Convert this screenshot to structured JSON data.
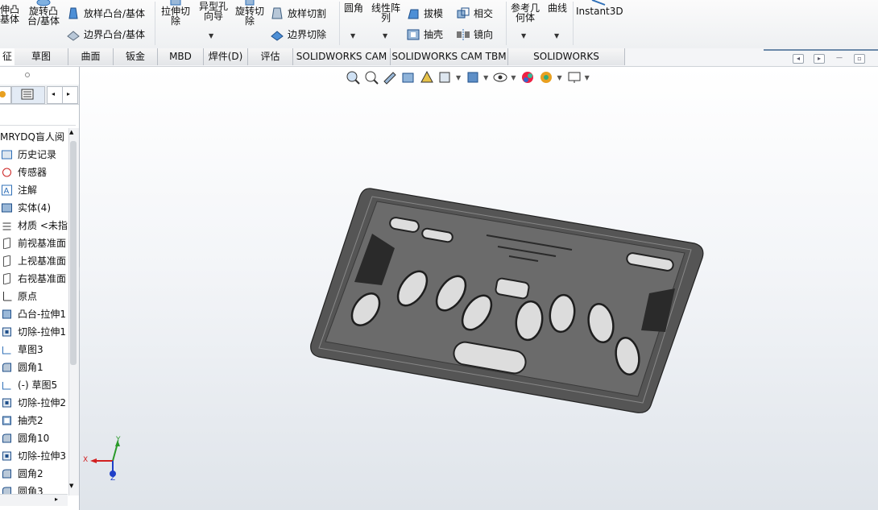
{
  "ribbon": {
    "boss_extrude": "伸凸\n基体",
    "revolve_boss": "旋转凸\n台/基体",
    "loft_boss": "放样凸台/基体",
    "boundary_boss": "边界凸台/基体",
    "extrude_cut": "拉伸切\n除",
    "hole_wizard": "异型孔\n向导",
    "revolve_cut": "旋转切\n除",
    "loft_cut": "放样切割",
    "boundary_cut": "边界切除",
    "fillet": "圆角",
    "linear_pattern": "线性阵\n列",
    "draft": "拔模",
    "intersect": "相交",
    "shell": "抽壳",
    "mirror": "镜向",
    "ref_geometry": "参考几\n何体",
    "curves": "曲线",
    "instant3d": "Instant3D"
  },
  "tabs": [
    "征",
    "草图",
    "曲面",
    "钣金",
    "MBD",
    "焊件(D)",
    "评估",
    "SOLIDWORKS CAM",
    "SOLIDWORKS CAM TBM",
    "SOLIDWORKS Inspection"
  ],
  "tree": {
    "root": "MRYDQ盲人阅",
    "items": [
      {
        "label": "历史记录",
        "icon": "history-icon"
      },
      {
        "label": "传感器",
        "icon": "sensor-icon"
      },
      {
        "label": "注解",
        "icon": "annotation-icon"
      },
      {
        "label": "实体(4)",
        "icon": "solid-bodies-icon"
      },
      {
        "label": "材质 <未指",
        "icon": "material-icon"
      },
      {
        "label": "前视基准面",
        "icon": "plane-icon"
      },
      {
        "label": "上视基准面",
        "icon": "plane-icon"
      },
      {
        "label": "右视基准面",
        "icon": "plane-icon"
      },
      {
        "label": "原点",
        "icon": "origin-icon"
      },
      {
        "label": "凸台-拉伸1",
        "icon": "boss-extrude-icon"
      },
      {
        "label": "切除-拉伸1",
        "icon": "cut-extrude-icon"
      },
      {
        "label": "草图3",
        "icon": "sketch-icon"
      },
      {
        "label": "圆角1",
        "icon": "fillet-icon"
      },
      {
        "label": "(-) 草图5",
        "icon": "sketch-icon"
      },
      {
        "label": "切除-拉伸2",
        "icon": "cut-extrude-icon"
      },
      {
        "label": "抽壳2",
        "icon": "shell-icon"
      },
      {
        "label": "圆角10",
        "icon": "fillet-icon"
      },
      {
        "label": "切除-拉伸3",
        "icon": "cut-extrude-icon"
      },
      {
        "label": "圆角2",
        "icon": "fillet-icon"
      },
      {
        "label": "圆角3",
        "icon": "fillet-icon"
      }
    ]
  },
  "triad": {
    "x": "X",
    "y": "Y",
    "z": "Z"
  },
  "colors": {
    "part": "#5a5a5a",
    "accent": "#2f6fb7",
    "x_axis": "#d22020",
    "y_axis": "#2a9a2a",
    "z_axis": "#1f3fc8"
  }
}
